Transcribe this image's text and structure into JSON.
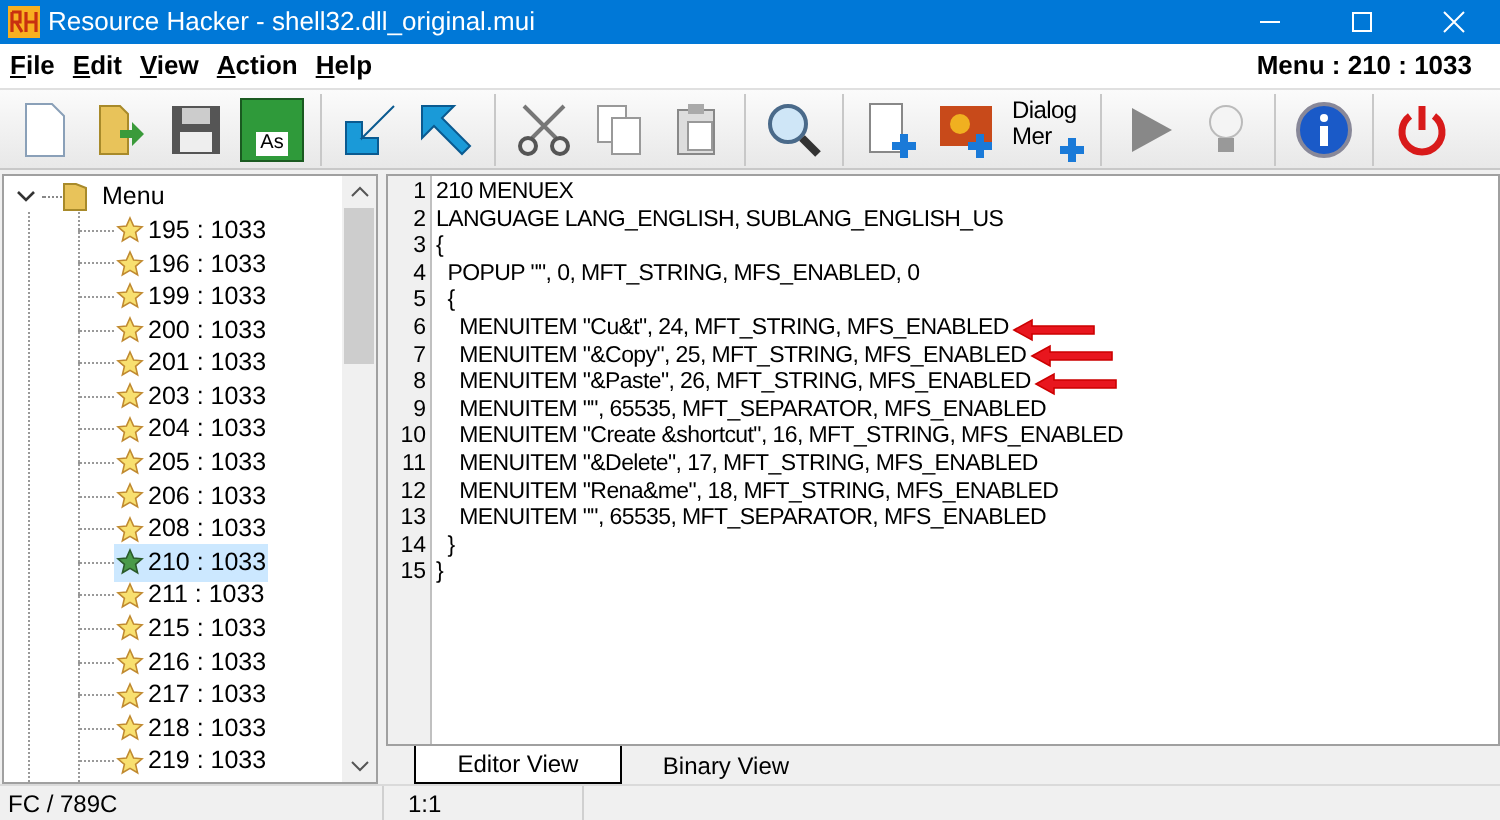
{
  "window": {
    "title": "Resource Hacker - shell32.dll_original.mui"
  },
  "menu_bar": [
    "File",
    "Edit",
    "View",
    "Action",
    "Help"
  ],
  "resource_id": "Menu : 210 : 1033",
  "toolbar": [
    {
      "kind": "new"
    },
    {
      "kind": "open"
    },
    {
      "kind": "save"
    },
    {
      "kind": "saveas",
      "label": "As"
    },
    {
      "kind": "sep"
    },
    {
      "kind": "import"
    },
    {
      "kind": "export"
    },
    {
      "kind": "sep"
    },
    {
      "kind": "cut"
    },
    {
      "kind": "copy"
    },
    {
      "kind": "paste"
    },
    {
      "kind": "sep"
    },
    {
      "kind": "search"
    },
    {
      "kind": "sep"
    },
    {
      "kind": "addblank"
    },
    {
      "kind": "addimage"
    },
    {
      "kind": "dialog",
      "label": "Dialog",
      "label2": "Mer"
    },
    {
      "kind": "sep"
    },
    {
      "kind": "run"
    },
    {
      "kind": "bulb"
    },
    {
      "kind": "sep"
    },
    {
      "kind": "info"
    },
    {
      "kind": "sep"
    },
    {
      "kind": "power"
    }
  ],
  "tree": {
    "label": "Menu",
    "expanded": true,
    "children": [
      {
        "label": "195 : 1033",
        "selected": false
      },
      {
        "label": "196 : 1033",
        "selected": false
      },
      {
        "label": "199 : 1033",
        "selected": false
      },
      {
        "label": "200 : 1033",
        "selected": false
      },
      {
        "label": "201 : 1033",
        "selected": false
      },
      {
        "label": "203 : 1033",
        "selected": false
      },
      {
        "label": "204 : 1033",
        "selected": false
      },
      {
        "label": "205 : 1033",
        "selected": false
      },
      {
        "label": "206 : 1033",
        "selected": false
      },
      {
        "label": "208 : 1033",
        "selected": false
      },
      {
        "label": "210 : 1033",
        "selected": true
      },
      {
        "label": "211 : 1033",
        "selected": false
      },
      {
        "label": "215 : 1033",
        "selected": false
      },
      {
        "label": "216 : 1033",
        "selected": false
      },
      {
        "label": "217 : 1033",
        "selected": false
      },
      {
        "label": "218 : 1033",
        "selected": false
      },
      {
        "label": "219 : 1033",
        "selected": false
      }
    ]
  },
  "editor": {
    "lines": [
      {
        "number": "1",
        "text": "210 MENUEX",
        "annotated": false
      },
      {
        "number": "2",
        "text": "LANGUAGE LANG_ENGLISH, SUBLANG_ENGLISH_US",
        "annotated": false
      },
      {
        "number": "3",
        "text": "{",
        "annotated": false
      },
      {
        "number": "4",
        "text": "  POPUP \"\", 0, MFT_STRING, MFS_ENABLED, 0",
        "annotated": false
      },
      {
        "number": "5",
        "text": "  {",
        "annotated": false
      },
      {
        "number": "6",
        "text": "    MENUITEM \"Cu&t\", 24, MFT_STRING, MFS_ENABLED",
        "annotated": true
      },
      {
        "number": "7",
        "text": "    MENUITEM \"&Copy\", 25, MFT_STRING, MFS_ENABLED",
        "annotated": true
      },
      {
        "number": "8",
        "text": "    MENUITEM \"&Paste\", 26, MFT_STRING, MFS_ENABLED",
        "annotated": true
      },
      {
        "number": "9",
        "text": "    MENUITEM \"\", 65535, MFT_SEPARATOR, MFS_ENABLED",
        "annotated": false
      },
      {
        "number": "10",
        "text": "    MENUITEM \"Create &shortcut\", 16, MFT_STRING, MFS_ENABLED",
        "annotated": false
      },
      {
        "number": "11",
        "text": "    MENUITEM \"&Delete\", 17, MFT_STRING, MFS_ENABLED",
        "annotated": false
      },
      {
        "number": "12",
        "text": "    MENUITEM \"Rena&me\", 18, MFT_STRING, MFS_ENABLED",
        "annotated": false
      },
      {
        "number": "13",
        "text": "    MENUITEM \"\", 65535, MFT_SEPARATOR, MFS_ENABLED",
        "annotated": false
      },
      {
        "number": "14",
        "text": "  }",
        "annotated": false
      },
      {
        "number": "15",
        "text": "}",
        "annotated": false
      }
    ]
  },
  "tabs": [
    {
      "label": "Editor View",
      "selected": true
    },
    {
      "label": "Binary View",
      "selected": false
    }
  ],
  "status_bar": {
    "offset": "FC / 789C",
    "position": "1:1"
  }
}
